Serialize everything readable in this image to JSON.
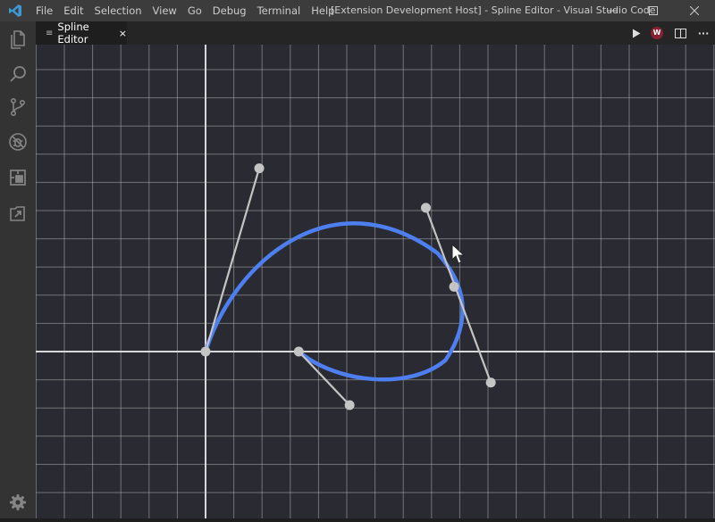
{
  "menu": [
    "File",
    "Edit",
    "Selection",
    "View",
    "Go",
    "Debug",
    "Terminal",
    "Help"
  ],
  "window_title": "[Extension Development Host] - Spline Editor - Visual Studio Code",
  "activity_icons": [
    "files-icon",
    "search-icon",
    "source-control-icon",
    "debug-icon",
    "extensions-icon",
    "remote-icon"
  ],
  "tab": {
    "label": "Spline Editor",
    "close": "×"
  },
  "editor_actions": {
    "avatar_letter": "W",
    "more": "···"
  },
  "colors": {
    "curve": "#4d7ff0",
    "handle": "#c4c4c4",
    "grid": "#c8c8c8",
    "background": "#2a2b32"
  },
  "spline": {
    "origin": [
      0,
      0
    ],
    "anchors": [
      [
        0,
        0
      ],
      [
        8.8,
        2.3
      ],
      [
        3.3,
        0
      ]
    ],
    "handles": [
      [
        [
          0,
          0
        ],
        [
          1.9,
          6.5
        ]
      ],
      [
        [
          7.8,
          5.1
        ],
        [
          10.1,
          -1.1
        ]
      ],
      [
        [
          3.3,
          0
        ],
        [
          5.1,
          -1.9
        ]
      ]
    ]
  }
}
